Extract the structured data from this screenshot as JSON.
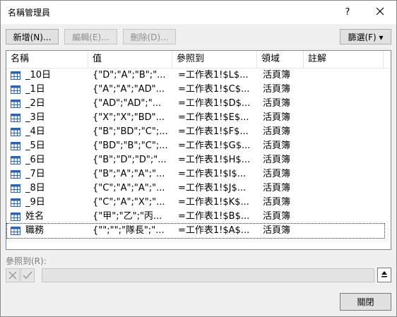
{
  "window": {
    "title": "名稱管理員",
    "help": "?",
    "close": "✕"
  },
  "toolbar": {
    "new_label": "新增(N)...",
    "edit_label": "編輯(E)...",
    "delete_label": "刪除(D)...",
    "filter_label": "篩選(F) ▾"
  },
  "columns": [
    "名稱",
    "值",
    "參照到",
    "領域",
    "註解"
  ],
  "rows": [
    {
      "name": "_10日",
      "value": "{\"D\";\"A\";\"B\";\"...",
      "ref": "=工作表1!$L$...",
      "scope": "活頁簿",
      "comment": ""
    },
    {
      "name": "_1日",
      "value": "{\"A\";\"A\";\"AD\"...",
      "ref": "=工作表1!$C$...",
      "scope": "活頁簿",
      "comment": ""
    },
    {
      "name": "_2日",
      "value": "{\"AD\";\"AD\";\"...",
      "ref": "=工作表1!$D$...",
      "scope": "活頁簿",
      "comment": ""
    },
    {
      "name": "_3日",
      "value": "{\"X\";\"X\";\"BD\"...",
      "ref": "=工作表1!$E$...",
      "scope": "活頁簿",
      "comment": ""
    },
    {
      "name": "_4日",
      "value": "{\"B\";\"BD\";\"C\";...",
      "ref": "=工作表1!$F$...",
      "scope": "活頁簿",
      "comment": ""
    },
    {
      "name": "_5日",
      "value": "{\"BD\";\"B\";\"C\";...",
      "ref": "=工作表1!$G$...",
      "scope": "活頁簿",
      "comment": ""
    },
    {
      "name": "_6日",
      "value": "{\"B\";\"D\";\"D\";\"...",
      "ref": "=工作表1!$H$...",
      "scope": "活頁簿",
      "comment": ""
    },
    {
      "name": "_7日",
      "value": "{\"B\";\"A\";\"A\";\"...",
      "ref": "=工作表1!$I$...",
      "scope": "活頁簿",
      "comment": ""
    },
    {
      "name": "_8日",
      "value": "{\"C\";\"A\";\"A\";\"...",
      "ref": "=工作表1!$J$...",
      "scope": "活頁簿",
      "comment": ""
    },
    {
      "name": "_9日",
      "value": "{\"C\";\"A\";\"X\";\"...",
      "ref": "=工作表1!$K$...",
      "scope": "活頁簿",
      "comment": ""
    },
    {
      "name": "姓名",
      "value": "{\"甲\";\"乙\";\"丙...",
      "ref": "=工作表1!$B$...",
      "scope": "活頁簿",
      "comment": ""
    },
    {
      "name": "職務",
      "value": "{\"\";\"\";\"隊長\";\"...",
      "ref": "=工作表1!$A$...",
      "scope": "活頁簿",
      "comment": ""
    }
  ],
  "refers_to": {
    "label": "參照到(R):",
    "value": ""
  },
  "footer": {
    "close_label": "關閉"
  },
  "colors": {
    "icon_blue": "#2a62b8",
    "disabled_text": "#8d8d8d"
  }
}
